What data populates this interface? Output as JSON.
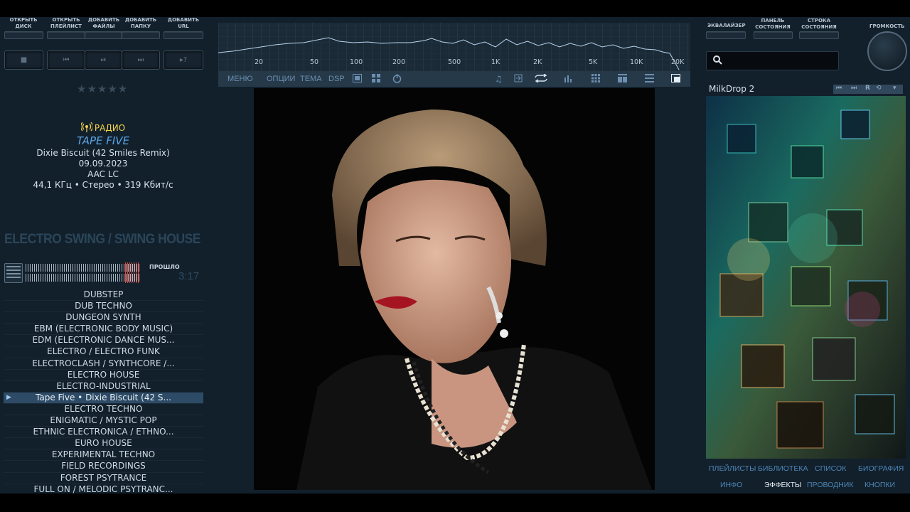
{
  "toolbar": {
    "open_disc": [
      "ОТКРЫТЬ",
      "ДИСК"
    ],
    "open_playlist": [
      "ОТКРЫТЬ",
      "ПЛЕЙЛИСТ"
    ],
    "add_files": [
      "ДОБАВИТЬ",
      "ФАЙЛЫ"
    ],
    "add_folder": [
      "ДОБАВИТЬ",
      "ПАПКУ"
    ],
    "add_url": [
      "ДОБАВИТЬ",
      "URL"
    ],
    "stop": "■",
    "prev": "⏮",
    "play_pause": "⏯",
    "next": "⏭",
    "help": "▸?"
  },
  "rating": "★★★★★",
  "now_playing": {
    "source": "РАДИО",
    "artist": "TAPE FIVE",
    "title": "Dixie Biscuit (42 Smiles Remix)",
    "date": "09.09.2023",
    "codec": "AAC LC",
    "format": "44,1 КГц • Стерео • 319 Кбит/с"
  },
  "genre_header": "ELECTRO SWING / SWING HOUSE",
  "time": {
    "label": "ПРОШЛО",
    "value": "3:17"
  },
  "playlist": [
    "DUBSTEP",
    "DUB TECHNO",
    "DUNGEON SYNTH",
    "EBM (ELECTRONIC BODY MUSIC)",
    "EDM (ELECTRONIC DANCE MUS...",
    "ELECTRO / ELECTRO FUNK",
    "ELECTROCLASH / SYNTHCORE /...",
    "ELECTRO HOUSE",
    "ELECTRO-INDUSTRIAL",
    "Tape Five • Dixie Biscuit (42 S...",
    "ELECTRO TECHNO",
    "ENIGMATIC / MYSTIC POP",
    "ETHNIC ELECTRONICA / ETHNO...",
    "EURO HOUSE",
    "EXPERIMENTAL TECHNO",
    "FIELD RECORDINGS",
    "FOREST PSYTRANCE",
    "FULL ON / MELODIC PSYTRANC...",
    "FUNKY HOUSE"
  ],
  "playing_index": 9,
  "spectrum_labels": [
    "20",
    "50",
    "100",
    "200",
    "500",
    "1K",
    "2K",
    "5K",
    "10K",
    "20K"
  ],
  "menu": {
    "menu": "МЕНЮ",
    "options": "ОПЦИИ",
    "theme": "ТЕМА",
    "dsp": "DSP"
  },
  "right_toolbar": {
    "equalizer": [
      "ЭКВАЛАЙЗЕР"
    ],
    "status_panel": [
      "ПАНЕЛЬ",
      "СОСТОЯНИЯ"
    ],
    "status_line": [
      "СТРОКА",
      "СОСТОЯНИЯ"
    ],
    "volume": "ГРОМКОСТЬ"
  },
  "visualizer": {
    "title": "MilkDrop 2",
    "r": "R"
  },
  "bottom_tabs": {
    "row1": [
      "ПЛЕЙЛИСТЫ",
      "БИБЛИОТЕКА",
      "СПИСОК",
      "БИОГРАФИЯ"
    ],
    "row2": [
      "ИНФО",
      "ЭФФЕКТЫ",
      "ПРОВОДНИК",
      "КНОПКИ"
    ],
    "active": "ЭФФЕКТЫ"
  },
  "colors": {
    "accent": "#5aa6e6",
    "radio": "#f4d44a",
    "bg": "#12202c"
  }
}
